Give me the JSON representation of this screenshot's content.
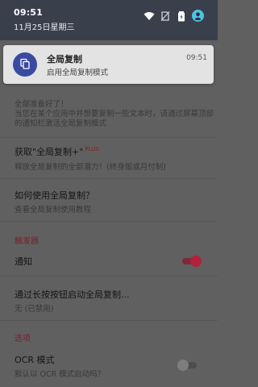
{
  "status_bar": {
    "time": "09:51",
    "date": "11月25日星期三",
    "icons": [
      "wifi-icon",
      "no-sim-icon",
      "battery-icon",
      "account-icon"
    ],
    "avatar_color": "#4fc3e0"
  },
  "notification": {
    "title": "全局复制",
    "text": "启用全局复制模式",
    "time": "09:51",
    "icon": "copy-icon",
    "icon_bg": "#3a4aa0"
  },
  "settings": {
    "intro": "全部准备好了！\n当您在某个应用中并想要复制一些文本时，请通过屏幕顶部的通知栏激活全局复制模式",
    "get_plus": {
      "title": "获取\"全局复制+\"",
      "badge": "PLUS",
      "subtitle": "释放全局复制的全部潜力！(终身版或月付制)"
    },
    "how_to": {
      "title": "如何使用全局复制？",
      "subtitle": "查看全局复制使用教程"
    },
    "triggers_section": "触发器",
    "notification_toggle": {
      "label": "通知",
      "enabled": true
    },
    "long_press": {
      "title": "通过长按按钮启动全局复制...",
      "subtitle": "无 (已禁用)"
    },
    "options_section": "选项",
    "ocr": {
      "title": "OCR 模式",
      "subtitle": "默认以 OCR 模式启动吗？",
      "enabled": false
    },
    "accent_color": "#b0223a"
  }
}
